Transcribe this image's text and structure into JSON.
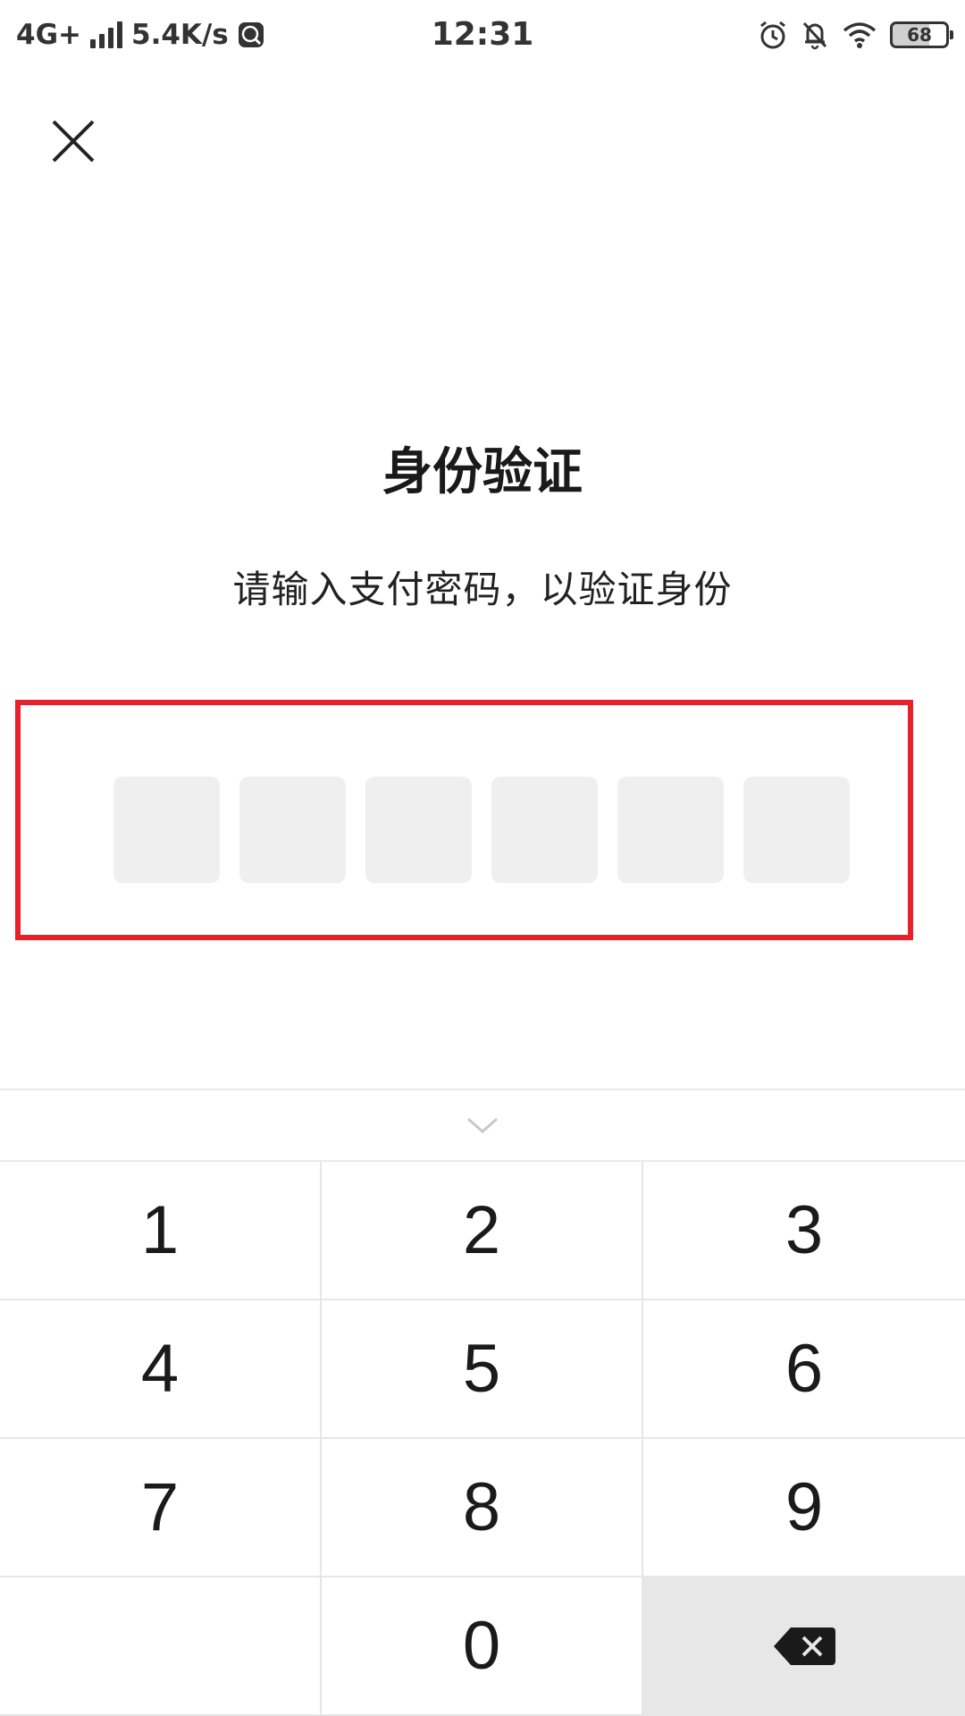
{
  "status_bar": {
    "network": "4G+",
    "speed": "5.4K/s",
    "time": "12:31",
    "battery": "68",
    "icons": [
      "signal-icon",
      "du-app-icon",
      "alarm-icon",
      "bell-off-icon",
      "wifi-icon",
      "battery-icon"
    ]
  },
  "dialog": {
    "close_icon": "close-icon",
    "title": "身份验证",
    "subtitle": "请输入支付密码，以验证身份",
    "pin_length": 6,
    "highlight_color": "#e8202a"
  },
  "keyboard": {
    "collapse_icon": "chevron-down-icon",
    "keys": [
      "1",
      "2",
      "3",
      "4",
      "5",
      "6",
      "7",
      "8",
      "9",
      "",
      "0",
      ""
    ],
    "delete_icon": "backspace-icon"
  }
}
